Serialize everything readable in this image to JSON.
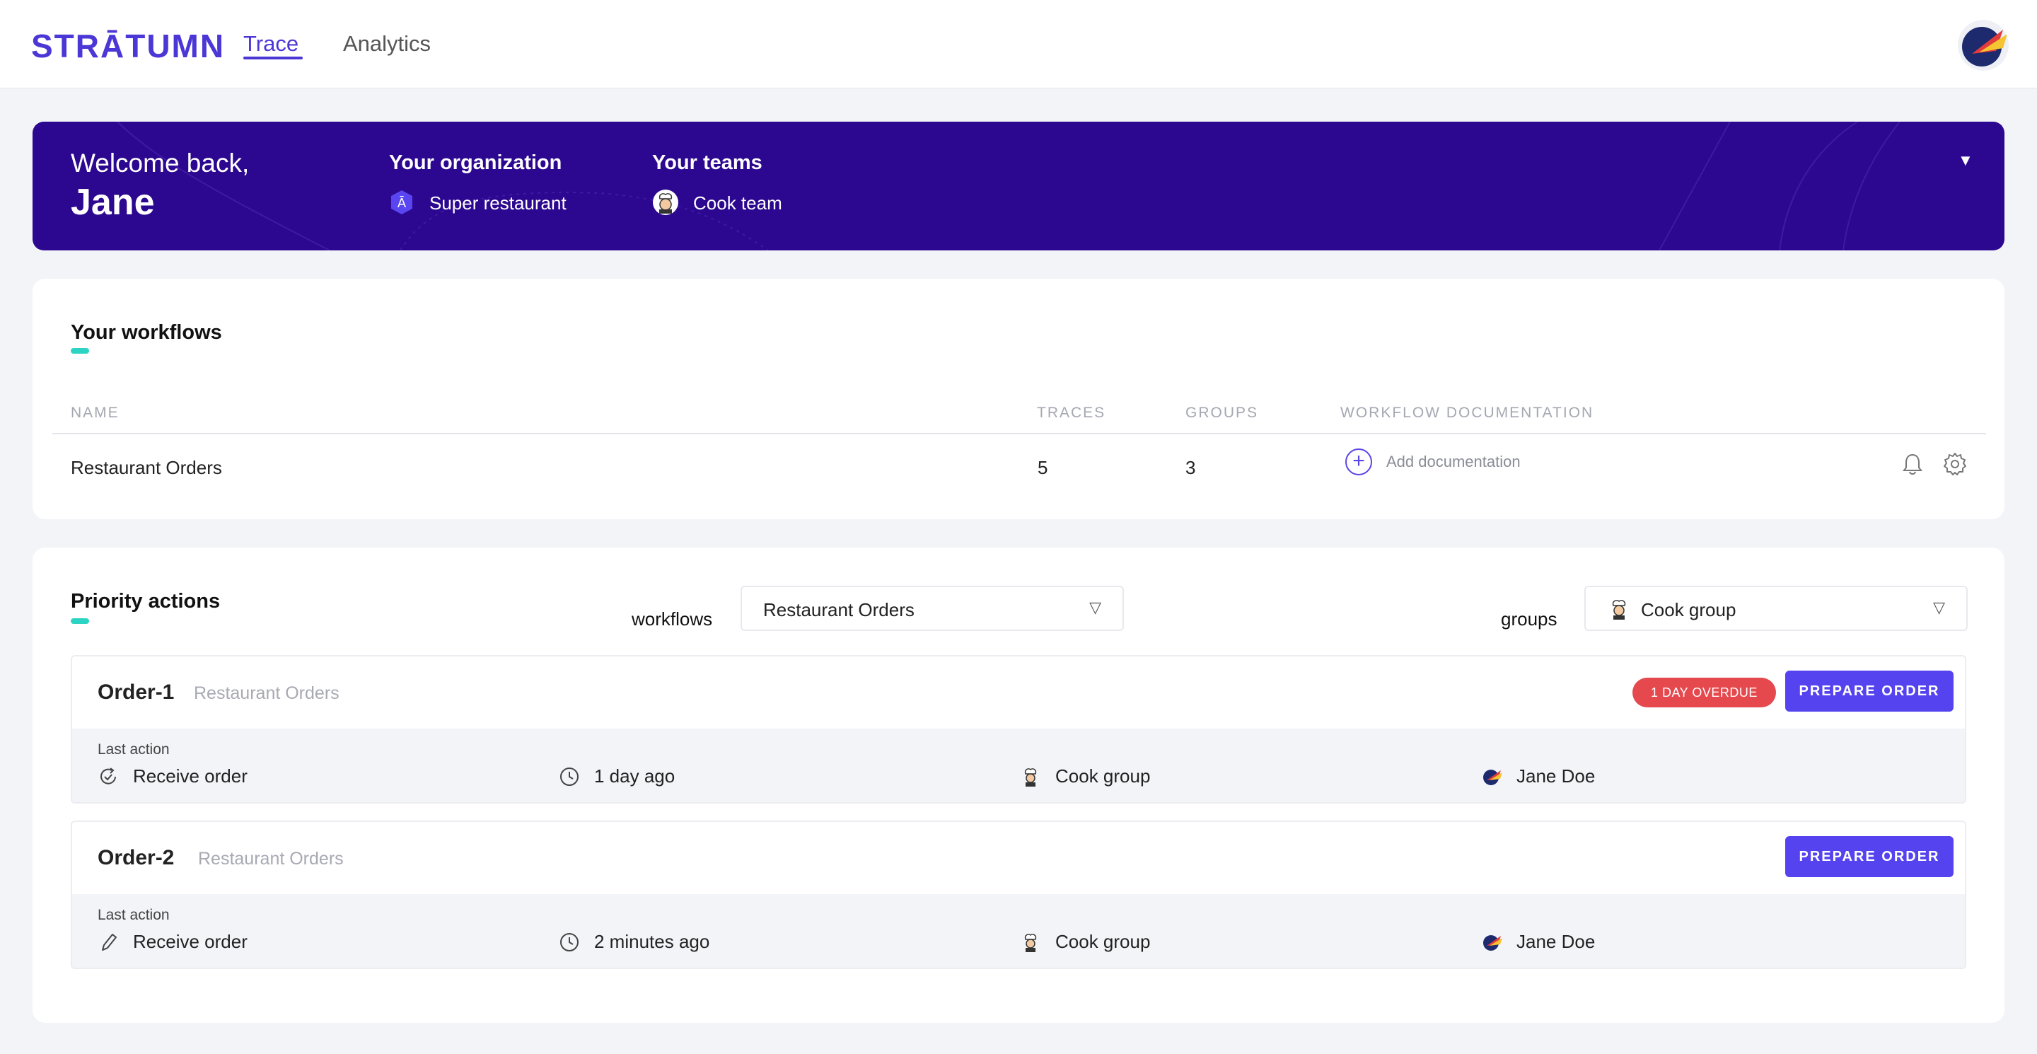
{
  "app": {
    "logo": "STRĀTUMN",
    "nav_tabs": [
      "Trace",
      "Analytics"
    ]
  },
  "banner": {
    "welcome": "Welcome back,",
    "name": "Jane",
    "organization_heading": "Your organization",
    "organization": "Super restaurant",
    "teams_heading": "Your teams",
    "team": "Cook team",
    "toggle_icon": "▼"
  },
  "workflows": {
    "title": "Your workflows",
    "columns": [
      "NAME",
      "TRACES",
      "GROUPS",
      "WORKFLOW DOCUMENTATION"
    ],
    "rows": [
      {
        "name": "Restaurant Orders",
        "traces": "5",
        "groups": "3",
        "documentation_action": "Add documentation"
      }
    ]
  },
  "priority": {
    "title": "Priority actions",
    "workflows_label": "workflows",
    "workflows_value": "Restaurant Orders",
    "groups_label": "groups",
    "groups_value": "Cook group",
    "orders": [
      {
        "id": "Order-1",
        "workflow": "Restaurant Orders",
        "badge": "1 DAY OVERDUE",
        "button": "PREPARE ORDER",
        "last_action_label": "Last action",
        "action": "Receive order",
        "time": "1 day ago",
        "group": "Cook group",
        "user": "Jane Doe"
      },
      {
        "id": "Order-2",
        "workflow": "Restaurant Orders",
        "button": "PREPARE ORDER",
        "last_action_label": "Last action",
        "action": "Receive order",
        "time": "2 minutes ago",
        "group": "Cook group",
        "user": "Jane Doe"
      }
    ]
  },
  "colors": {
    "brand": "#4b37d6",
    "banner": "#2c078f",
    "accent": "#2dd4c4",
    "button": "#5443ef",
    "overdue": "#e5484d"
  },
  "icons": [
    "bell-icon",
    "gear-icon",
    "clock-icon",
    "refresh-icon",
    "pencil-icon",
    "chef-icon",
    "organization-icon",
    "chevron-down-icon",
    "plus-icon"
  ]
}
